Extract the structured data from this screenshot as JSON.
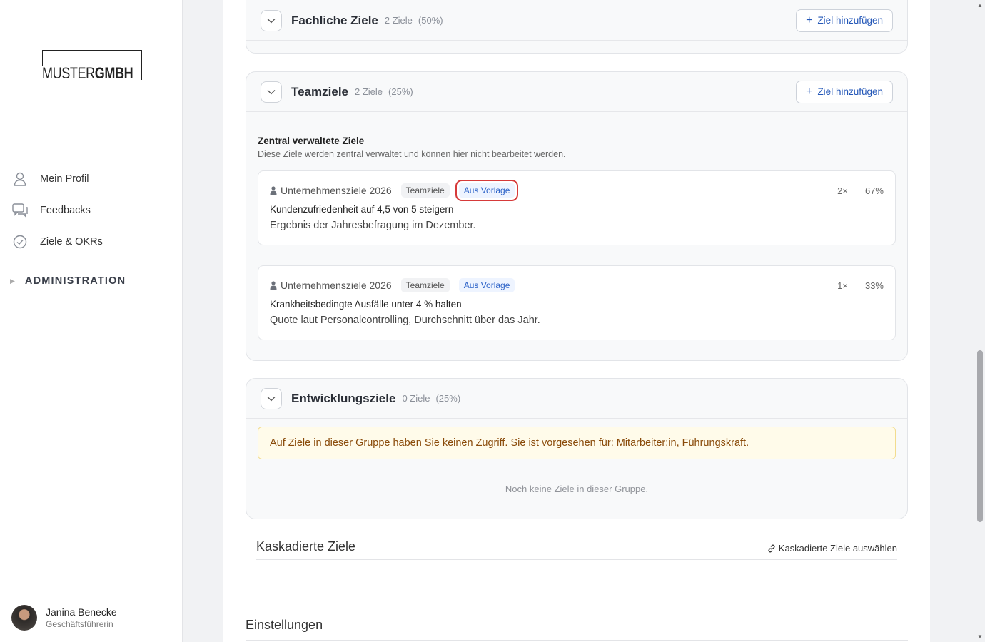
{
  "logo": {
    "light": "MUSTER",
    "bold": "GMBH"
  },
  "nav": {
    "items": [
      {
        "label": "Mein Profil",
        "icon": "user-icon"
      },
      {
        "label": "Feedbacks",
        "icon": "chat-icon"
      },
      {
        "label": "Ziele & OKRs",
        "icon": "check-circle-icon"
      }
    ],
    "admin_label": "ADMINISTRATION"
  },
  "user": {
    "name": "Janina Benecke",
    "role": "Geschäftsführerin"
  },
  "groups": {
    "fachlich": {
      "title": "Fachliche Ziele",
      "count": "2 Ziele",
      "pct": "(50%)",
      "add": "Ziel hinzufügen"
    },
    "team": {
      "title": "Teamziele",
      "count": "2 Ziele",
      "pct": "(25%)",
      "add": "Ziel hinzufügen",
      "section_title": "Zentral verwaltete Ziele",
      "section_sub": "Diese Ziele werden zentral verwaltet und können hier nicht bearbeitet werden.",
      "cards": [
        {
          "source": "Unternehmensziele 2026",
          "tag": "Teamziele",
          "badge": "Aus Vorlage",
          "weight": "2×",
          "pct": "67%",
          "title": "Kundenzufriedenheit auf 4,5 von 5 steigern",
          "desc": "Ergebnis der Jahresbefragung im Dezember."
        },
        {
          "source": "Unternehmensziele 2026",
          "tag": "Teamziele",
          "badge": "Aus Vorlage",
          "weight": "1×",
          "pct": "33%",
          "title": "Krankheitsbedingte Ausfälle unter 4 % halten",
          "desc": "Quote laut Personalcontrolling, Durchschnitt über das Jahr."
        }
      ]
    },
    "entwicklung": {
      "title": "Entwicklungsziele",
      "count": "0 Ziele",
      "pct": "(25%)",
      "warning": "Auf Ziele in dieser Gruppe haben Sie keinen Zugriff. Sie ist vorgesehen für: Mitarbeiter:in, Führungskraft.",
      "empty": "Noch keine Ziele in dieser Gruppe."
    }
  },
  "cascaded": {
    "title": "Kaskadierte Ziele",
    "link": "Kaskadierte Ziele auswählen"
  },
  "settings": {
    "title": "Einstellungen"
  },
  "colors": {
    "accent": "#2558b8",
    "highlight": "#d63a3a",
    "warning_bg": "#fffbea",
    "warning_text": "#8a4b0a"
  }
}
